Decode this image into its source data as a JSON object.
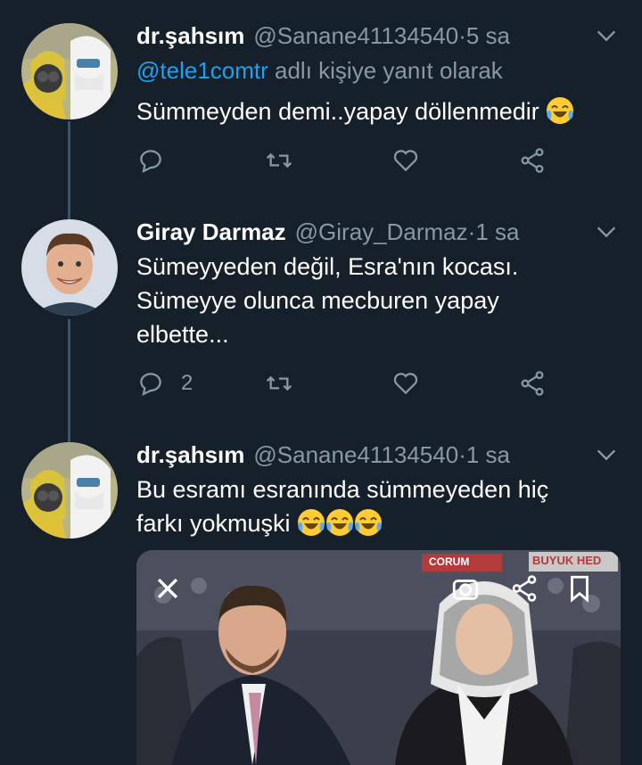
{
  "tweets": [
    {
      "name": "dr.şahsım",
      "handle": "@Sanane41134540",
      "time": "5 sa",
      "reply_prefix": "@tele1comtr",
      "reply_suffix": " adlı kişiye yanıt olarak",
      "text": "Sümmeyden demi..yapay döllenmedir",
      "emoji": "face-with-tears-of-joy",
      "reply_count": ""
    },
    {
      "name": "Giray Darmaz",
      "handle": "@Giray_Darmaz",
      "time": "1 sa",
      "text_line1": "Sümeyyeden değil, Esra'nın kocası.",
      "text_line2": "Sümeyye olunca mecburen yapay",
      "text_line3": "elbette...",
      "reply_count": "2"
    },
    {
      "name": "dr.şahsım",
      "handle": "@Sanane41134540",
      "time": "1 sa",
      "text_line1": "Bu esramı esranında sümmeyeden hiç",
      "text_line2": "farkı yokmuşki",
      "emoji_count": 3
    }
  ],
  "separator": " · ",
  "media": {
    "banner_text": "BUYUK HED",
    "banner_text_left": "CORUM"
  },
  "icons": [
    "reply-icon",
    "retweet-icon",
    "like-icon",
    "share-icon",
    "chevron-down-icon",
    "close-icon",
    "camera-icon",
    "bookmark-icon"
  ],
  "colors": {
    "background": "#15202b",
    "secondary_text": "#8899a6",
    "link": "#1da1f2",
    "thread_line": "#3d5466"
  }
}
